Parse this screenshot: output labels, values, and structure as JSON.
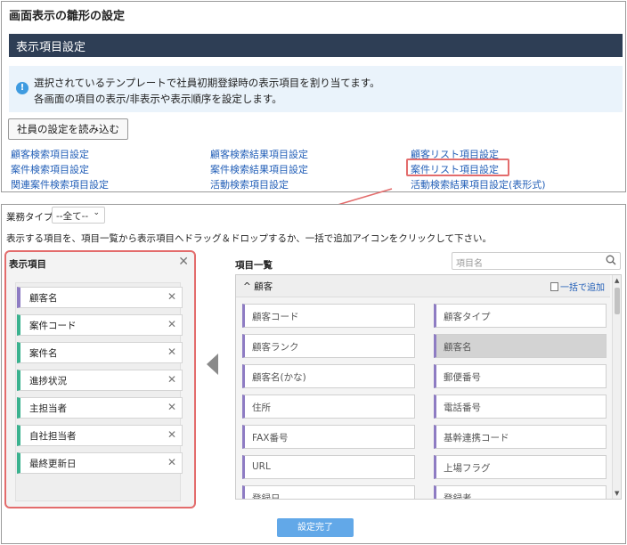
{
  "page_title": "画面表示の雛形の設定",
  "section_title": "表示項目設定",
  "info": {
    "icon": "info-icon",
    "line1": "選択されているテンプレートで社員初期登録時の表示項目を割り当てます。",
    "line2": "各画面の項目の表示/非表示や表示順序を設定します。"
  },
  "load_button": "社員の設定を読み込む",
  "links": [
    "顧客検索項目設定",
    "案件検索項目設定",
    "関連案件検索項目設定",
    "顧客検索結果項目設定",
    "案件検索結果項目設定",
    "活動検索項目設定",
    "顧客リスト項目設定",
    "案件リスト項目設定",
    "活動検索結果項目設定(表形式)"
  ],
  "business_type": {
    "label": "業務タイプ",
    "value": "--全て--"
  },
  "instruction": "表示する項目を、項目一覧から表示項目へドラッグ＆ドロップするか、一括で追加アイコンをクリックして下さい。",
  "selected": {
    "title": "表示項目",
    "items": [
      "顧客名",
      "案件コード",
      "案件名",
      "進捗状況",
      "主担当者",
      "自社担当者",
      "最終更新日"
    ]
  },
  "item_list": {
    "title": "項目一覧",
    "search_placeholder": "項目名",
    "group_name": "顧客",
    "add_all": "一括で追加",
    "fields": [
      "顧客コード",
      "顧客タイプ",
      "顧客ランク",
      "顧客名",
      "顧客名(かな)",
      "郵便番号",
      "住所",
      "電話番号",
      "FAX番号",
      "基幹連携コード",
      "URL",
      "上場フラグ",
      "登録日",
      "登録者"
    ]
  },
  "done_button": "設定完了",
  "colors": {
    "header_bg": "#2e3e55",
    "highlight": "#e36c6c",
    "link": "#2460b8",
    "primary_btn": "#62a8e8"
  }
}
